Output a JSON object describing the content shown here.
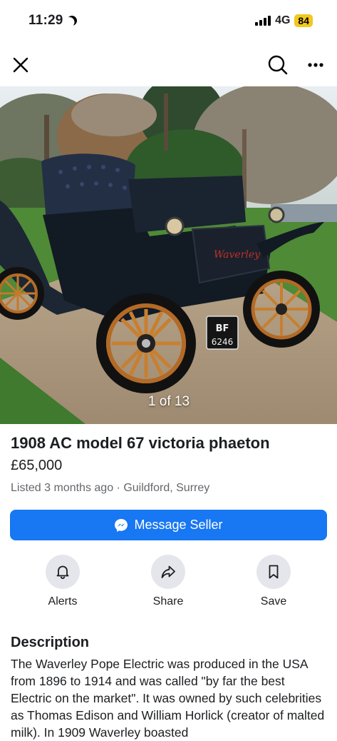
{
  "status_bar": {
    "time": "11:29",
    "network": "4G",
    "battery": "84"
  },
  "icons": {
    "close": "close-icon",
    "search": "search-icon",
    "more": "more-icon",
    "messenger": "messenger-icon",
    "alerts": "bell-icon",
    "share": "share-icon",
    "save": "bookmark-icon"
  },
  "photo": {
    "counter": "1 of 13",
    "plate_line1": "BF",
    "plate_line2": "6246"
  },
  "listing": {
    "title": "1908 AC model 67 victoria phaeton",
    "price": "£65,000",
    "meta": "Listed 3 months ago · Guildford, Surrey"
  },
  "actions": {
    "message_label": "Message Seller",
    "alerts_label": "Alerts",
    "share_label": "Share",
    "save_label": "Save"
  },
  "description": {
    "heading": "Description",
    "body": "The Waverley Pope Electric was produced in the USA from 1896 to 1914 and was called \"by far the best Electric on the market\". It was owned by such celebrities as Thomas Edison and William Horlick (creator of malted milk). In 1909 Waverley boasted"
  },
  "colors": {
    "accent": "#1877f2",
    "secondary_text": "#65676b",
    "button_bg": "#e4e6eb",
    "battery": "#f2c81c"
  }
}
